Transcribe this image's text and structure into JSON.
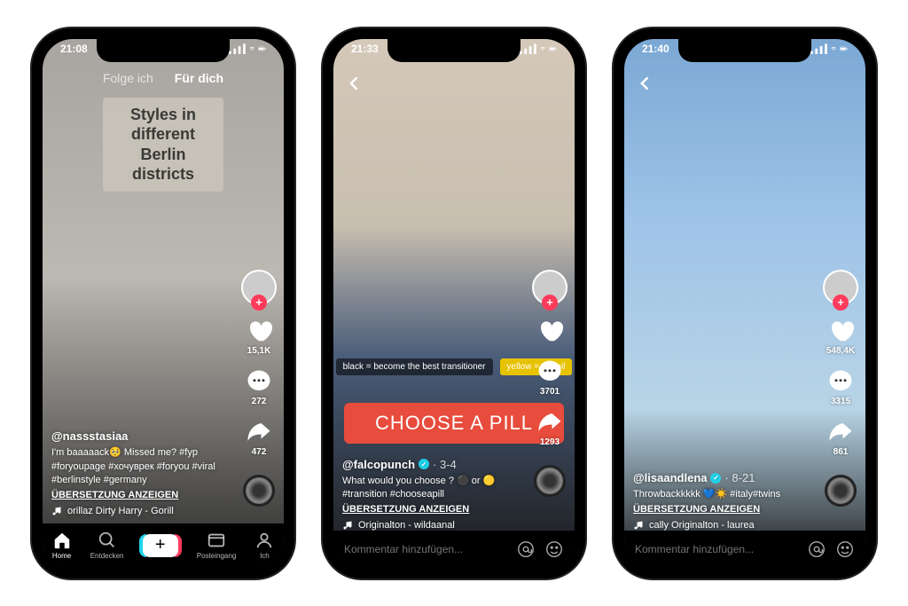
{
  "phones": [
    {
      "time": "21:08",
      "top_nav": {
        "following": "Folge ich",
        "foryou": "Für dich"
      },
      "overlay_title": "Styles in different\nBerlin districts",
      "likes": "15,1K",
      "comments": "272",
      "shares": "472",
      "user": "@nassstasiaa",
      "caption": "I'm baaaaack🥺 Missed me? #fyp #foryoupage #хочуврек #foryou #viral #berlinstyle #germany",
      "translate": "ÜBERSETZUNG ANZEIGEN",
      "sound": "orillaz   Dirty Harry - Gorill",
      "nav": {
        "home": "Home",
        "discover": "Entdecken",
        "inbox": "Posteingang",
        "me": "Ich"
      }
    },
    {
      "time": "21:33",
      "likes": "",
      "comments": "3701",
      "shares": "1293",
      "user": "@falcopunch",
      "date": "· 3-4",
      "pill_black": "black = become the best transitioner",
      "pill_yellow": "yellow = 1$ mil",
      "choose": "CHOOSE A PILL",
      "caption": "What would you choose ? ⚫ or 🟡 #transition #chooseapill",
      "translate": "ÜBERSETZUNG ANZEIGEN",
      "sound": "Originalton - wildaanal",
      "comment_placeholder": "Kommentar hinzufügen..."
    },
    {
      "time": "21:40",
      "likes": "548,4K",
      "comments": "3315",
      "shares": "861",
      "user": "@lisaandlena",
      "date": "· 8-21",
      "caption": "Throwbackkkkk 💙☀️ #italy#twins",
      "translate": "ÜBERSETZUNG ANZEIGEN",
      "sound": "cally   Originalton - laurea",
      "comment_placeholder": "Kommentar hinzufügen..."
    }
  ]
}
